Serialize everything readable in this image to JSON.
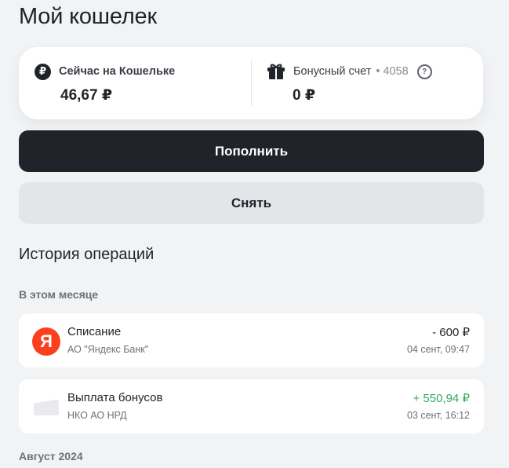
{
  "page": {
    "title": "Мой кошелек"
  },
  "balance": {
    "wallet_label": "Сейчас на Кошельке",
    "wallet_value": "46,67 ₽",
    "bonus_label": "Бонусный счет",
    "bonus_sep": "•",
    "bonus_account": "4058",
    "bonus_value": "0 ₽"
  },
  "actions": {
    "topup_label": "Пополнить",
    "withdraw_label": "Снять"
  },
  "history": {
    "title": "История операций",
    "groups": [
      {
        "label": "В этом месяце",
        "items": [
          {
            "icon": "yandex-logo",
            "icon_letter": "Я",
            "title": "Списание",
            "org": "АО \"Яндекс Банк\"",
            "amount": "- 600 ₽",
            "date": "04 сент, 09:47",
            "positive": false
          },
          {
            "icon": "card-placeholder",
            "title": "Выплата бонусов",
            "org": "НКО АО НРД",
            "amount": "+ 550,94 ₽",
            "date": "03 сент, 16:12",
            "positive": true
          }
        ]
      },
      {
        "label": "Август 2024",
        "items": []
      }
    ]
  },
  "colors": {
    "dark": "#21232b",
    "positive": "#2fae58",
    "yandex": "#fc3f1d",
    "background": "#f2f3f5"
  }
}
